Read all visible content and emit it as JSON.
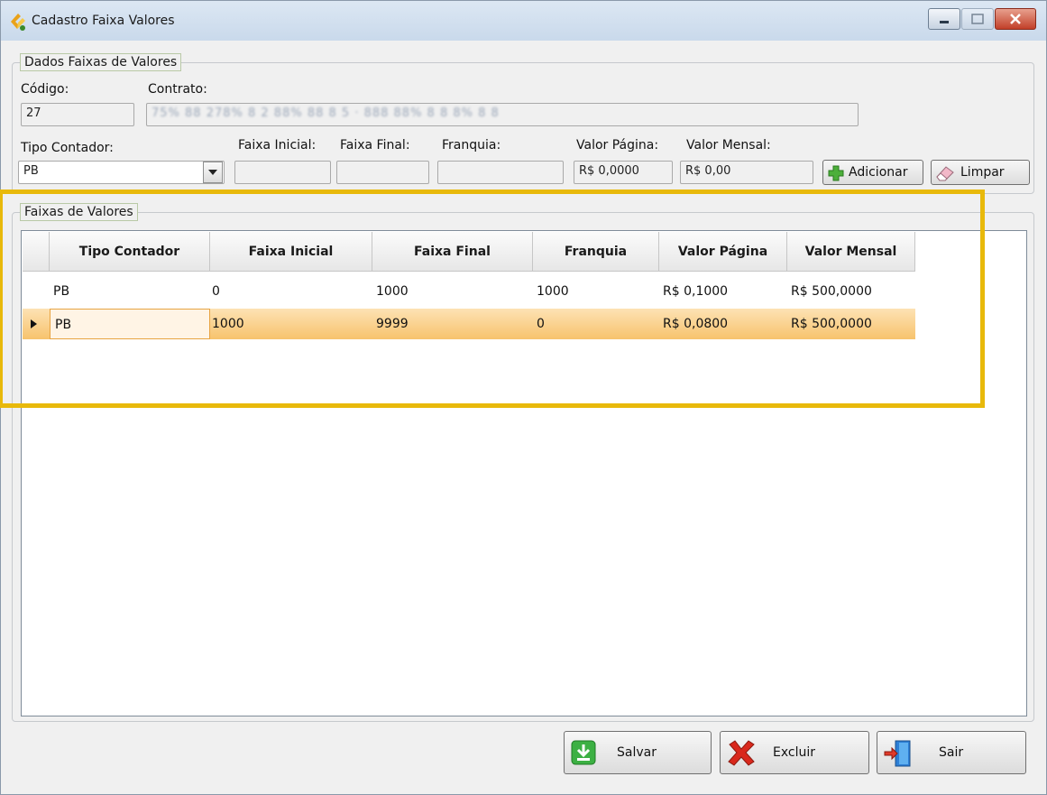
{
  "window": {
    "title": "Cadastro Faixa Valores"
  },
  "dados": {
    "legend": "Dados Faixas de Valores",
    "codigo_label": "Código:",
    "codigo_value": "27",
    "contrato_label": "Contrato:",
    "contrato_value": "75% 88 278% 8 2 88% 88 8 5 · 888 88% 8 8 8% 8 8",
    "tipo_label": "Tipo Contador:",
    "tipo_value": "PB",
    "faixa_inicial_label": "Faixa Inicial:",
    "faixa_final_label": "Faixa Final:",
    "franquia_label": "Franquia:",
    "valor_pagina_label": "Valor Página:",
    "valor_pagina_value": "R$ 0,0000",
    "valor_mensal_label": "Valor Mensal:",
    "valor_mensal_value": "R$ 0,00",
    "adicionar_label": "Adicionar",
    "limpar_label": "Limpar"
  },
  "faixas": {
    "legend": "Faixas de Valores",
    "columns": [
      "Tipo Contador",
      "Faixa Inicial",
      "Faixa Final",
      "Franquia",
      "Valor Página",
      "Valor Mensal"
    ],
    "rows": [
      [
        "PB",
        "0",
        "1000",
        "1000",
        "R$ 0,1000",
        "R$ 500,0000"
      ],
      [
        "PB",
        "1000",
        "9999",
        "0",
        "R$ 0,0800",
        "R$ 500,0000"
      ]
    ],
    "selected_row": 1
  },
  "actions": {
    "salvar": "Salvar",
    "excluir": "Excluir",
    "sair": "Sair"
  },
  "colors": {
    "highlight": "#e8b90b",
    "selected_row": "#f7c36d"
  }
}
